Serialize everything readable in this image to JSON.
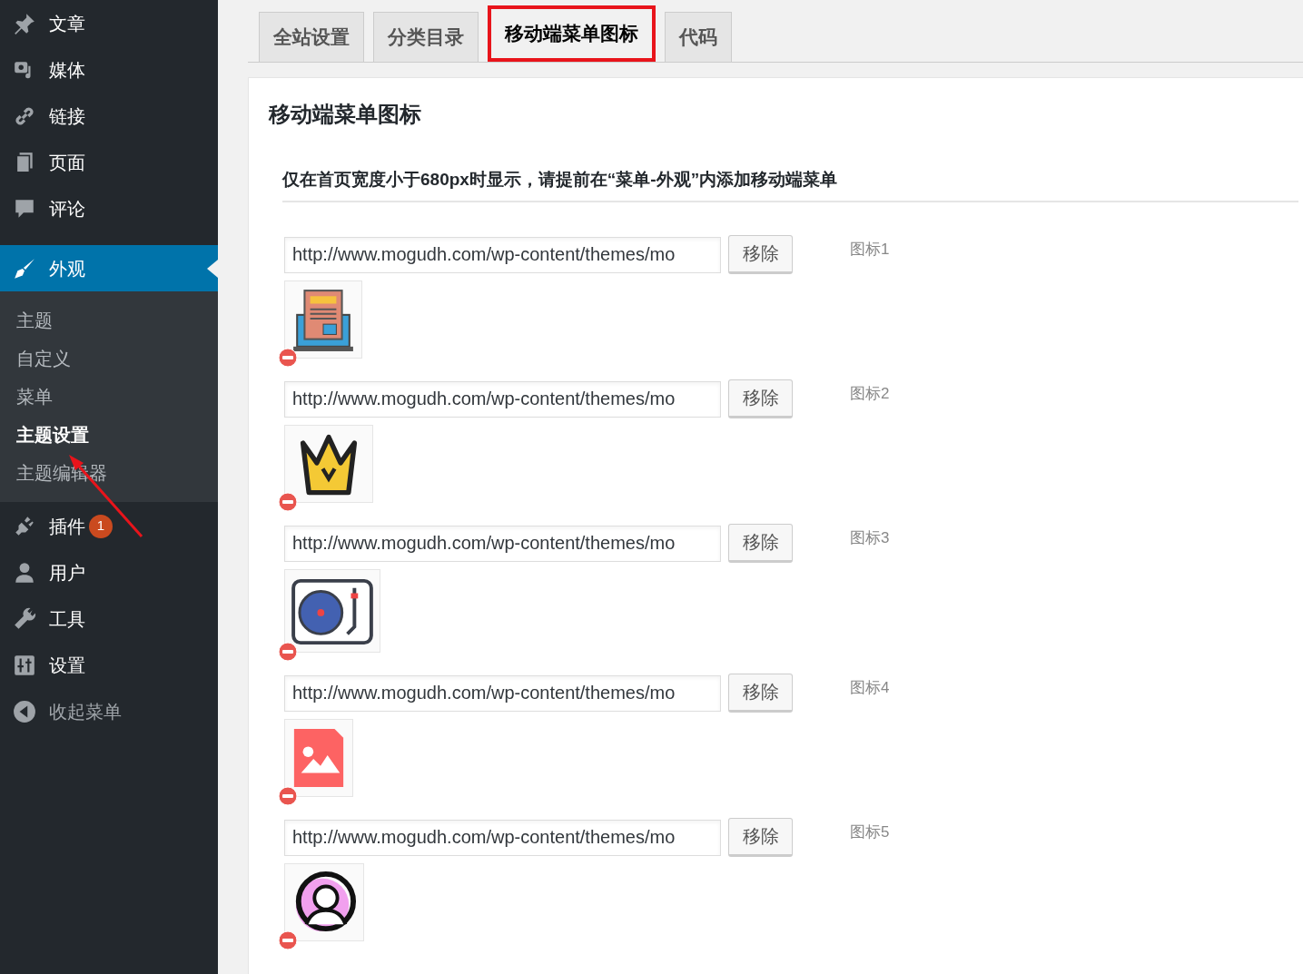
{
  "sidebar": {
    "items": [
      {
        "label": "文章",
        "kind": "pin",
        "selected": false
      },
      {
        "label": "媒体",
        "kind": "media",
        "selected": false
      },
      {
        "label": "链接",
        "kind": "link",
        "selected": false
      },
      {
        "label": "页面",
        "kind": "pages",
        "selected": false
      },
      {
        "label": "评论",
        "kind": "comment",
        "selected": false
      },
      {
        "label": "外观",
        "kind": "brush",
        "selected": true,
        "children": [
          {
            "label": "主题",
            "selected": false
          },
          {
            "label": "自定义",
            "selected": false
          },
          {
            "label": "菜单",
            "selected": false
          },
          {
            "label": "主题设置",
            "selected": true
          },
          {
            "label": "主题编辑器",
            "selected": false
          }
        ]
      },
      {
        "label": "插件",
        "kind": "plug",
        "selected": false,
        "badge": "1"
      },
      {
        "label": "用户",
        "kind": "user",
        "selected": false
      },
      {
        "label": "工具",
        "kind": "wrench",
        "selected": false
      },
      {
        "label": "设置",
        "kind": "sliders",
        "selected": false
      },
      {
        "label": "收起菜单",
        "kind": "collapse",
        "selected": false
      }
    ]
  },
  "tabs": [
    {
      "label": "全站设置",
      "selected": false
    },
    {
      "label": "分类目录",
      "selected": false
    },
    {
      "label": "移动端菜单图标",
      "selected": true
    },
    {
      "label": "代码",
      "selected": false
    }
  ],
  "panel": {
    "title": "移动端菜单图标",
    "description": "仅在首页宽度小于680px时显示，请提前在“菜单-外观”内添加移动端菜单",
    "icons": [
      {
        "url": "http://www.mogudh.com/wp-content/themes/mo",
        "button": "移除",
        "label": "图标1",
        "kind": "laptop"
      },
      {
        "url": "http://www.mogudh.com/wp-content/themes/mo",
        "button": "移除",
        "label": "图标2",
        "kind": "crown"
      },
      {
        "url": "http://www.mogudh.com/wp-content/themes/mo",
        "button": "移除",
        "label": "图标3",
        "kind": "turntable"
      },
      {
        "url": "http://www.mogudh.com/wp-content/themes/mo",
        "button": "移除",
        "label": "图标4",
        "kind": "image"
      },
      {
        "url": "http://www.mogudh.com/wp-content/themes/mo",
        "button": "移除",
        "label": "图标5",
        "kind": "avatar"
      }
    ]
  }
}
